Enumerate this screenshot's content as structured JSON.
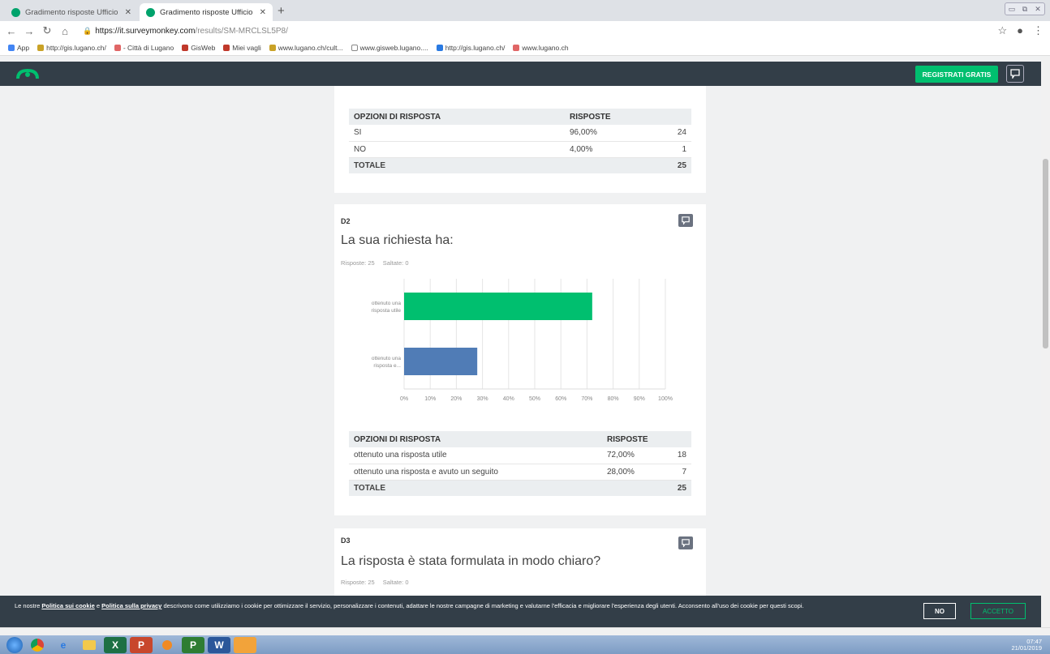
{
  "browser": {
    "tabs": [
      {
        "title": "Gradimento risposte Ufficio qua",
        "active": false
      },
      {
        "title": "Gradimento risposte Ufficio qua",
        "active": true
      }
    ],
    "new_tab": "+",
    "url_host": "https://it.surveymonkey.com",
    "url_path": "/results/SM-MRCLSL5P8/",
    "bookmarks": [
      "App",
      "http://gis.lugano.ch/",
      "- Città di Lugano",
      "GisWeb",
      "Miei vagli",
      "www.lugano.ch/cult...",
      "www.gisweb.lugano....",
      "http://gis.lugano.ch/",
      "www.lugano.ch"
    ]
  },
  "header": {
    "register_label": "REGISTRATI GRATIS"
  },
  "q1_table": {
    "col_option": "OPZIONI DI RISPOSTA",
    "col_responses": "RISPOSTE",
    "rows": [
      {
        "option": "SI",
        "pct": "96,00%",
        "count": "24"
      },
      {
        "option": "NO",
        "pct": "4,00%",
        "count": "1"
      }
    ],
    "total_label": "TOTALE",
    "total_count": "25"
  },
  "q2": {
    "id": "D2",
    "title": "La sua richiesta ha:",
    "answered": "Risposte: 25",
    "skipped": "Saltate: 0",
    "table": {
      "col_option": "OPZIONI DI RISPOSTA",
      "col_responses": "RISPOSTE",
      "rows": [
        {
          "option": "ottenuto una risposta utile",
          "pct": "72,00%",
          "count": "18"
        },
        {
          "option": "ottenuto una risposta e avuto un seguito",
          "pct": "28,00%",
          "count": "7"
        }
      ],
      "total_label": "TOTALE",
      "total_count": "25"
    }
  },
  "q3": {
    "id": "D3",
    "title": "La risposta è stata formulata in modo chiaro?",
    "answered": "Risposte: 25",
    "skipped": "Saltate: 0"
  },
  "cookie_bar": {
    "prefix": "Le nostre ",
    "link1": "Politica sui cookie",
    "mid": " e ",
    "link2": "Politica sulla privacy",
    "text": " descrivono come utilizziamo i cookie per ottimizzare il servizio, personalizzare i contenuti, adattare le nostre campagne di marketing e valutarne l'efficacia e migliorare l'esperienza degli utenti. Acconsento all'uso dei cookie per questi scopi.",
    "no_label": "NO",
    "accept_label": "ACCETTO"
  },
  "taskbar": {
    "time": "07:47",
    "date": "21/01/2019"
  },
  "colors": {
    "bar_green": "#00bf6f",
    "bar_blue": "#507cb6",
    "header_bg": "#333e48"
  },
  "chart_data": {
    "type": "bar",
    "orientation": "horizontal",
    "categories": [
      "ottenuto una risposta utile",
      "ottenuto una risposta e..."
    ],
    "values": [
      72,
      28
    ],
    "bar_colors": [
      "#00bf6f",
      "#507cb6"
    ],
    "xlim": [
      0,
      100
    ],
    "xticks": [
      "0%",
      "10%",
      "20%",
      "30%",
      "40%",
      "50%",
      "60%",
      "70%",
      "80%",
      "90%",
      "100%"
    ],
    "grid": true
  }
}
